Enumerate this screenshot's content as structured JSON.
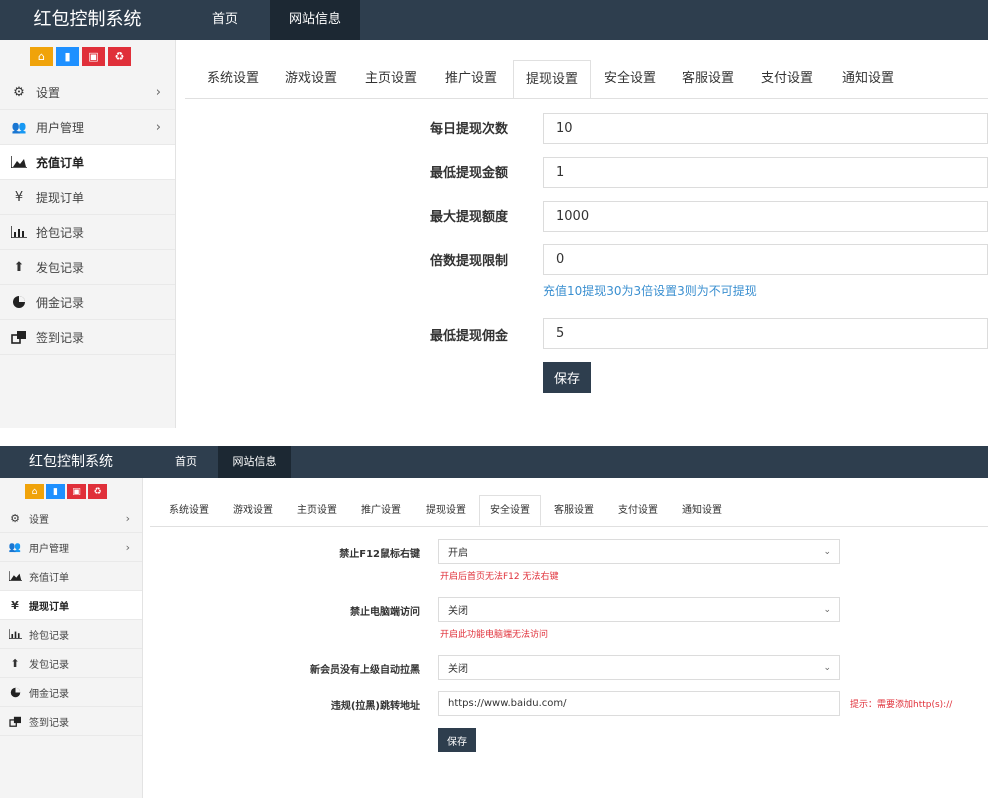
{
  "app_title": "红包控制系统",
  "nav": {
    "home": "首页",
    "site_info": "网站信息"
  },
  "sidebar": {
    "items": [
      {
        "label": "设置",
        "icon": "gears-icon",
        "has_chevron": true
      },
      {
        "label": "用户管理",
        "icon": "users-icon",
        "has_chevron": true
      },
      {
        "label": "充值订单",
        "icon": "area-chart-icon"
      },
      {
        "label": "提现订单",
        "icon": "yen-icon"
      },
      {
        "label": "抢包记录",
        "icon": "bar-chart-icon"
      },
      {
        "label": "发包记录",
        "icon": "upload-icon"
      },
      {
        "label": "佣金记录",
        "icon": "pie-chart-icon"
      },
      {
        "label": "签到记录",
        "icon": "windows-icon"
      }
    ]
  },
  "quick_buttons": [
    {
      "name": "home-icon",
      "color": "#f0a30a"
    },
    {
      "name": "file-icon",
      "color": "#1e90ff"
    },
    {
      "name": "trash-icon",
      "color": "#e0303a"
    },
    {
      "name": "recycle-icon",
      "color": "#e0303a"
    }
  ],
  "tabs": [
    "系统设置",
    "游戏设置",
    "主页设置",
    "推广设置",
    "提现设置",
    "安全设置",
    "客服设置",
    "支付设置",
    "通知设置"
  ],
  "withdraw_form": {
    "daily_count_label": "每日提现次数",
    "daily_count_value": "10",
    "min_amount_label": "最低提现金额",
    "min_amount_value": "1",
    "max_amount_label": "最大提现额度",
    "max_amount_value": "1000",
    "multiple_label": "倍数提现限制",
    "multiple_value": "0",
    "multiple_hint": "充值10提现30为3倍设置3则为不可提现",
    "min_commission_label": "最低提现佣金",
    "min_commission_value": "5",
    "save_label": "保存"
  },
  "security_form": {
    "f12_label": "禁止F12鼠标右键",
    "f12_value": "开启",
    "f12_hint": "开启后首页无法F12 无法右键",
    "pc_label": "禁止电脑端访问",
    "pc_value": "关闭",
    "pc_hint": "开启此功能电脑端无法访问",
    "blacklist_label": "新会员没有上级自动拉黑",
    "blacklist_value": "关闭",
    "redirect_label": "违规(拉黑)跳转地址",
    "redirect_value": "https://www.baidu.com/",
    "redirect_tip": "提示：需要添加http(s)://",
    "save_label": "保存"
  },
  "colors": {
    "topbar": "#2e3e4e",
    "nav_active": "#1c2833",
    "hint_blue": "#3a8fd0",
    "hint_red": "#e0303a"
  }
}
